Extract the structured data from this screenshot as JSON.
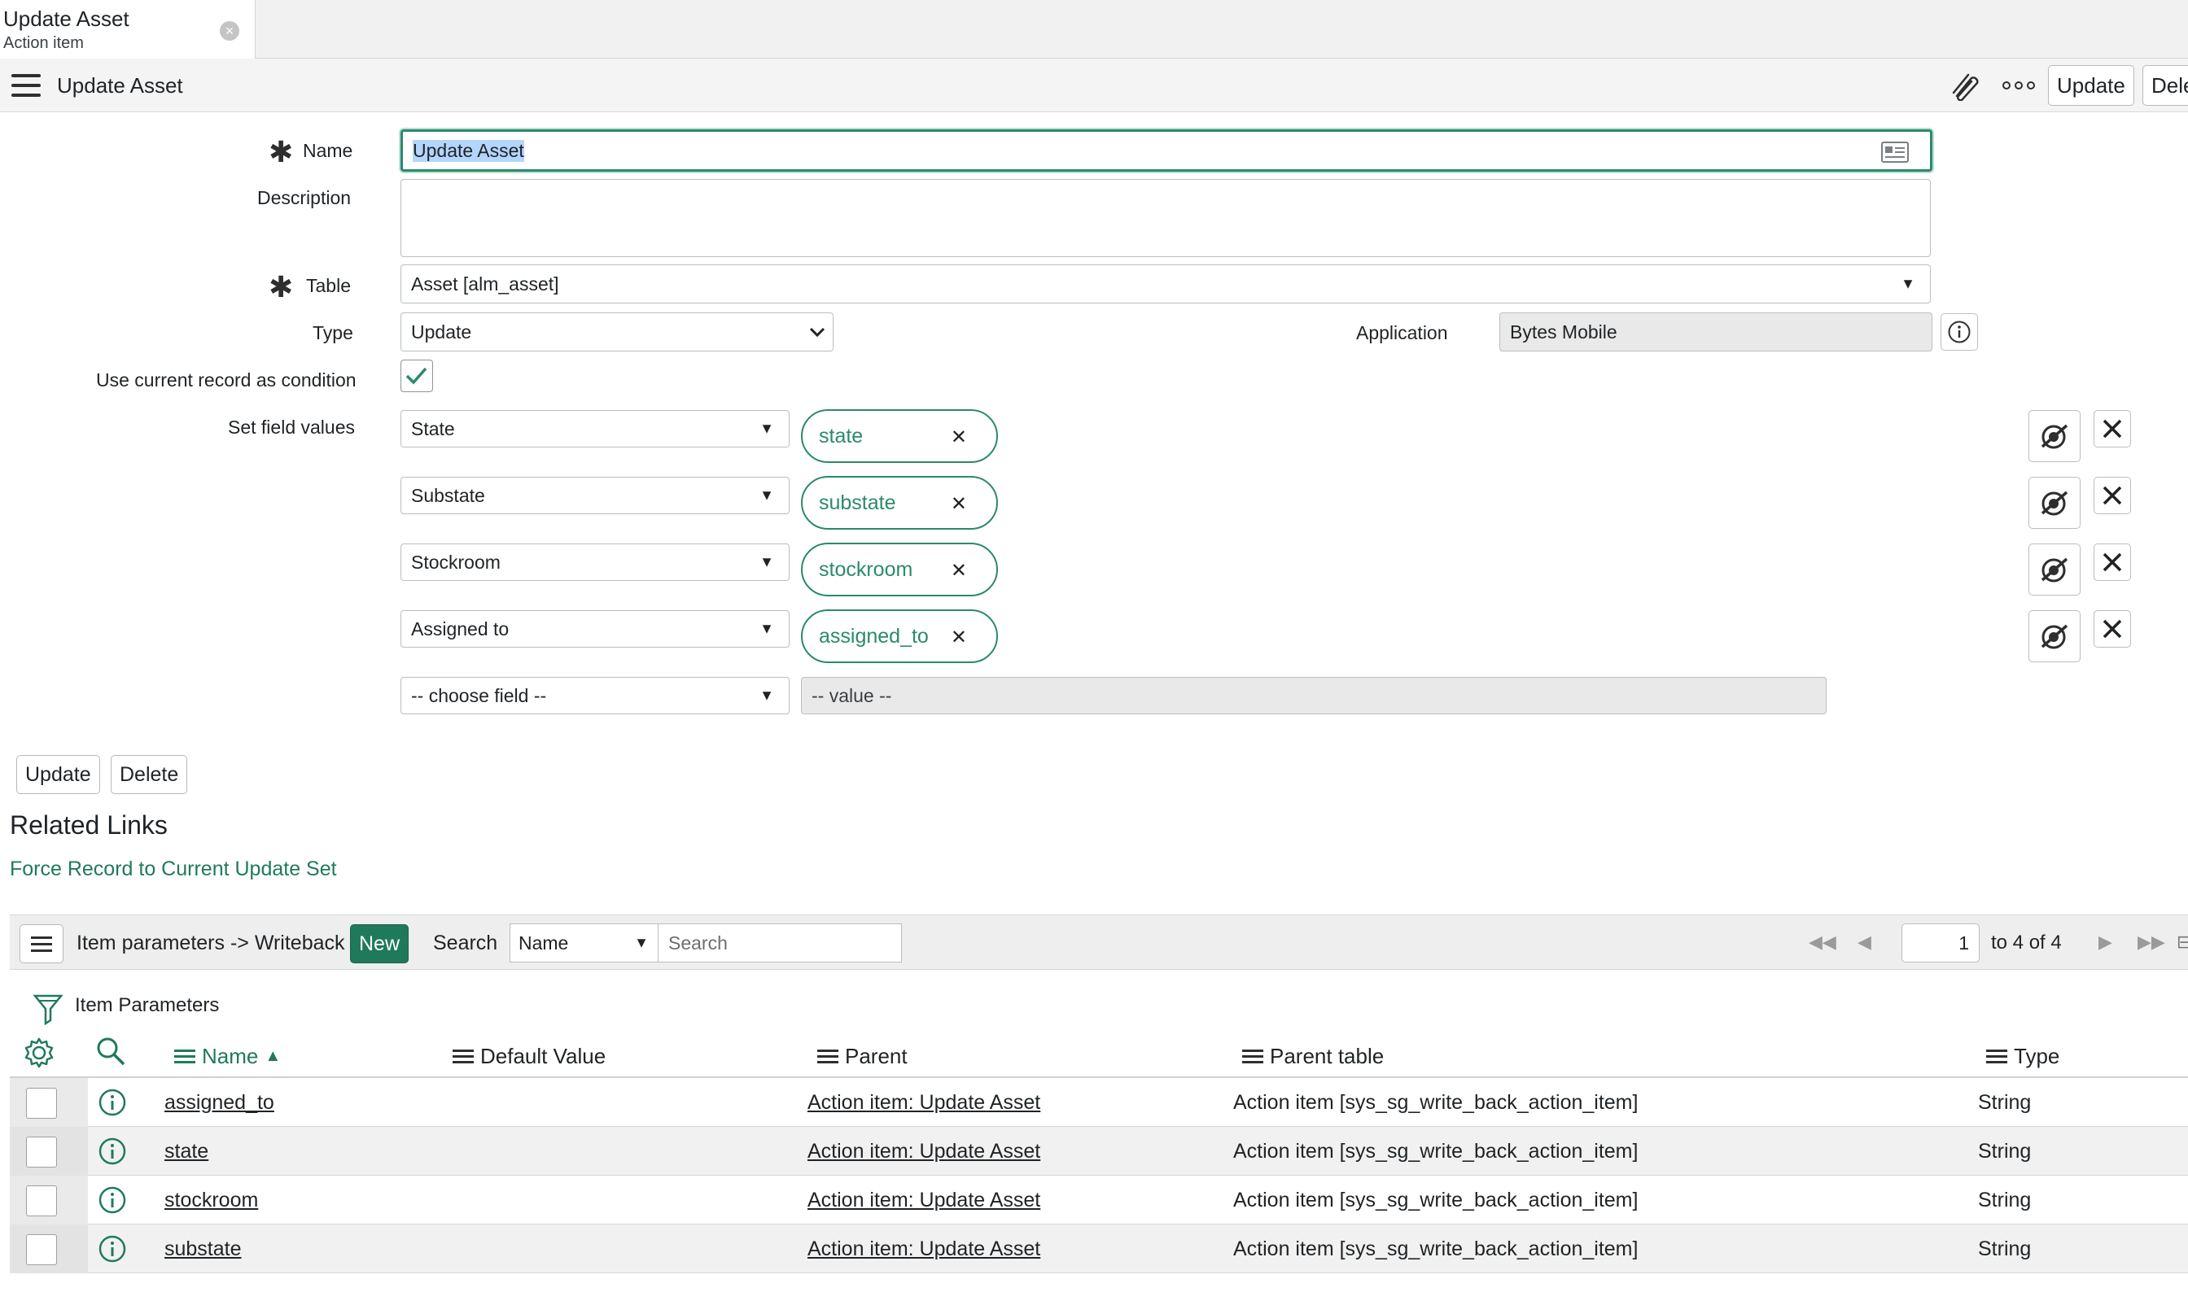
{
  "tab": {
    "title": "Update Asset",
    "subtitle": "Action item"
  },
  "header": {
    "title": "Update Asset",
    "update_label": "Update",
    "delete_label": "Dele"
  },
  "form": {
    "name_label": "Name",
    "name_value": "Update Asset",
    "description_label": "Description",
    "description_value": "",
    "table_label": "Table",
    "table_value": "Asset [alm_asset]",
    "type_label": "Type",
    "type_value": "Update",
    "application_label": "Application",
    "application_value": "Bytes Mobile",
    "use_current_label": "Use current record as condition",
    "use_current_checked": true,
    "set_field_values_label": "Set field values",
    "field_rows": [
      {
        "field": "State",
        "value": "state"
      },
      {
        "field": "Substate",
        "value": "substate"
      },
      {
        "field": "Stockroom",
        "value": "stockroom"
      },
      {
        "field": "Assigned to",
        "value": "assigned_to"
      }
    ],
    "choose_field_placeholder": "-- choose field --",
    "value_placeholder": "-- value --",
    "update_label": "Update",
    "delete_label": "Delete"
  },
  "related_links": {
    "title": "Related Links",
    "link": "Force Record to Current Update Set"
  },
  "related_list": {
    "title": "Item parameters -> Writeback",
    "new_label": "New",
    "search_label": "Search",
    "search_field": "Name",
    "search_placeholder": "Search",
    "page": "1",
    "page_of": "to 4 of 4",
    "filter_label": "Item Parameters",
    "columns": [
      "Name",
      "Default Value",
      "Parent",
      "Parent table",
      "Type"
    ],
    "rows": [
      {
        "name": "assigned_to",
        "default_value": "",
        "parent": "Action item: Update Asset",
        "parent_table": "Action item [sys_sg_write_back_action_item]",
        "type": "String"
      },
      {
        "name": "state",
        "default_value": "",
        "parent": "Action item: Update Asset",
        "parent_table": "Action item [sys_sg_write_back_action_item]",
        "type": "String"
      },
      {
        "name": "stockroom",
        "default_value": "",
        "parent": "Action item: Update Asset",
        "parent_table": "Action item [sys_sg_write_back_action_item]",
        "type": "String"
      },
      {
        "name": "substate",
        "default_value": "",
        "parent": "Action item: Update Asset",
        "parent_table": "Action item [sys_sg_write_back_action_item]",
        "type": "String"
      }
    ]
  },
  "colors": {
    "accent": "#2b8a6c",
    "link": "#207a5a",
    "new_button": "#1f7a5c"
  }
}
